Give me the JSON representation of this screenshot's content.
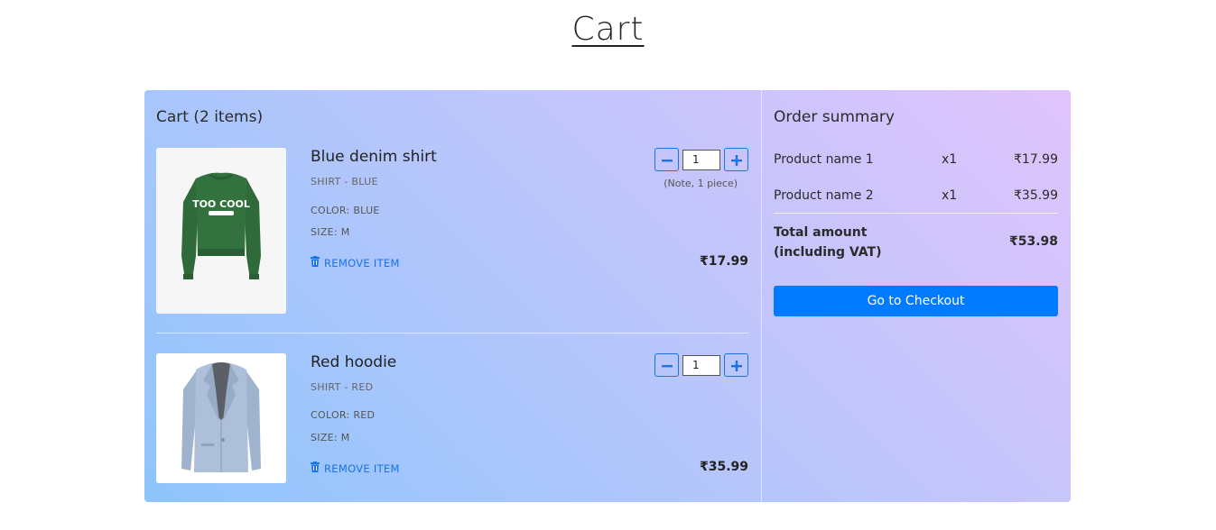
{
  "page": {
    "title": "Cart"
  },
  "cart": {
    "heading": "Cart (2 items)",
    "items": [
      {
        "name": "Blue denim shirt",
        "subtitle": "SHIRT - BLUE",
        "color": "COLOR: BLUE",
        "size": "SIZE: M",
        "remove_label": "REMOVE ITEM",
        "quantity": "1",
        "note": "(Note, 1 piece)",
        "price": "₹17.99",
        "image": "green-sweatshirt-too-cool"
      },
      {
        "name": "Red hoodie",
        "subtitle": "SHIRT - RED",
        "color": "COLOR: RED",
        "size": "SIZE: M",
        "remove_label": "REMOVE ITEM",
        "quantity": "1",
        "price": "₹35.99",
        "image": "grey-blazer"
      }
    ]
  },
  "summary": {
    "heading": "Order summary",
    "rows": [
      {
        "name": "Product name 1",
        "qty": "x1",
        "price": "₹17.99"
      },
      {
        "name": "Product name 2",
        "qty": "x1",
        "price": "₹35.99"
      }
    ],
    "total_label_line1": "Total amount",
    "total_label_line2": "(including VAT)",
    "total_value": "₹53.98",
    "checkout_label": "Go to Checkout"
  },
  "colors": {
    "accent": "#007bff",
    "link": "#1a73e8",
    "gradient_start": "#8ec5fc",
    "gradient_end": "#e0c3fc"
  },
  "icons": {
    "minus": "minus-icon",
    "plus": "plus-icon",
    "remove": "trash-icon"
  }
}
